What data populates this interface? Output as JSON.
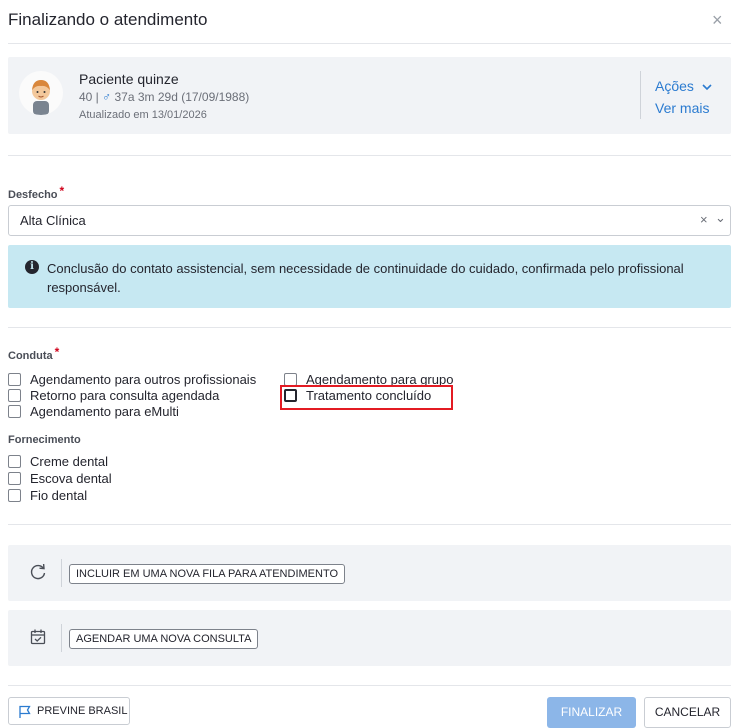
{
  "modal": {
    "title": "Finalizando o atendimento",
    "close_glyph": "×"
  },
  "patient": {
    "name": "Paciente quinze",
    "id_age_prefix": "40 |",
    "sex_symbol": "♂",
    "age_birth": "37a 3m 29d (17/09/1988)",
    "updated": "Atualizado em 13/01/2026",
    "actions_label": "Ações",
    "more_label": "Ver mais"
  },
  "desfecho": {
    "label": "Desfecho",
    "required_mark": "*",
    "selected_value": "Alta Clínica",
    "clear_glyph": "×",
    "chevron_glyph": "⌄"
  },
  "info_alert": {
    "icon": "info-icon",
    "text": "Conclusão do contato assistencial, sem necessidade de continuidade do cuidado, confirmada pelo profissional responsável."
  },
  "conduta": {
    "label": "Conduta",
    "required_mark": "*",
    "options": [
      {
        "label": "Agendamento para outros profissionais",
        "checked": false
      },
      {
        "label": "Retorno para consulta agendada",
        "checked": false
      },
      {
        "label": "Agendamento para eMulti",
        "checked": false
      },
      {
        "label": "Agendamento para grupo",
        "checked": false
      },
      {
        "label": "Tratamento concluído",
        "checked": false
      }
    ]
  },
  "fornecimento": {
    "label": "Fornecimento",
    "options": [
      {
        "label": "Creme dental",
        "checked": false
      },
      {
        "label": "Escova dental",
        "checked": false
      },
      {
        "label": "Fio dental",
        "checked": false
      }
    ]
  },
  "actions": {
    "queue_button": "INCLUIR EM UMA NOVA FILA PARA ATENDIMENTO",
    "schedule_button": "AGENDAR UMA NOVA CONSULTA"
  },
  "footer": {
    "previne_label": "PREVINE BRASIL",
    "finalize_label": "FINALIZAR",
    "cancel_label": "CANCELAR"
  },
  "colors": {
    "accent_blue": "#2b7bd0",
    "finalize_bg": "#8cb6e8",
    "alert_bg": "#c6e8f2",
    "highlight_red": "#e31b23",
    "card_bg": "#f1f3f6"
  }
}
